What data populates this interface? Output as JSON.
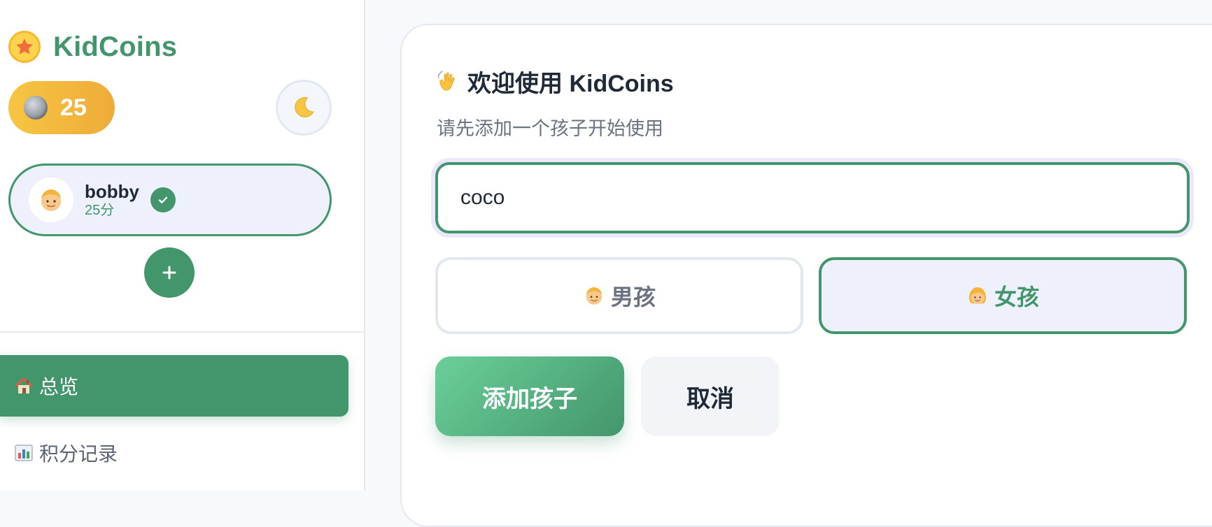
{
  "sidebar": {
    "brand": {
      "title": "KidCoins",
      "logo_icon": "star-icon"
    },
    "coins": {
      "icon": "coin-icon",
      "value": "25"
    },
    "theme_toggle": {
      "icon": "moon-icon"
    },
    "children": [
      {
        "name": "bobby",
        "score": "25分",
        "avatar_icon": "boy-face-icon",
        "selected": true
      }
    ],
    "add_child_icon": "plus-icon",
    "nav": [
      {
        "label": "总览",
        "icon": "house-icon",
        "active": true
      },
      {
        "label": "积分记录",
        "icon": "bar-chart-icon",
        "active": false
      }
    ]
  },
  "main": {
    "welcome": {
      "title": "欢迎使用 KidCoins",
      "title_icon": "waving-hand-icon",
      "subtitle": "请先添加一个孩子开始使用"
    },
    "name_input": {
      "value": "coco"
    },
    "gender": {
      "boy_label": "男孩",
      "girl_label": "女孩",
      "selected": "girl"
    },
    "actions": {
      "submit_label": "添加孩子",
      "cancel_label": "取消"
    }
  },
  "colors": {
    "accent": "#43966b",
    "coin_gold": "#f6c542",
    "selected_bg": "#eef0fc",
    "focus_ring": "#ebe8fb"
  }
}
